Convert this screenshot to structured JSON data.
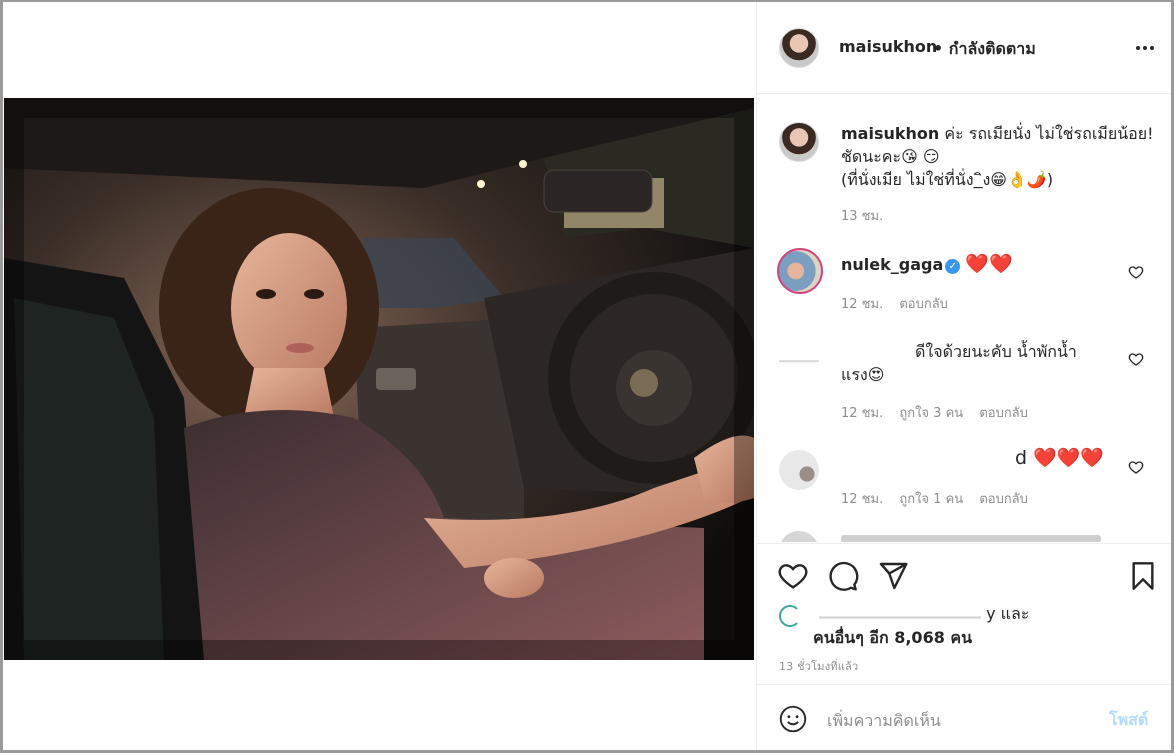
{
  "post": {
    "username": "maisukhon",
    "follow_status": "• กำลังติดตาม",
    "caption": {
      "username": "maisukhon",
      "line1": "ค่ะ รถเมียนั่ง ไม่ใช่รถเมียน้อย!",
      "line2": "ชัดนะคะ😘 😏",
      "line3": "(ที่นั่งเมีย ไม่ใช่ที่นั่ง_ิง😁👌🌶️)",
      "time": "13 ชม."
    },
    "comments": [
      {
        "username": "nulek_gaga",
        "verified_mark": "✓",
        "text": "❤️❤️",
        "time": "12 ชม.",
        "reply": "ตอบกลับ"
      },
      {
        "line1": "ดีใจด้วยนะคับ น้ำพักน้ำ",
        "line2": "แรง😍",
        "time": "12 ชม.",
        "likes": "ถูกใจ 3 คน",
        "reply": "ตอบกลับ"
      },
      {
        "text": "d ❤️❤️❤️",
        "time": "12 ชม.",
        "likes": "ถูกใจ 1 คน",
        "reply": "ตอบกลับ"
      }
    ],
    "likes_partial": "y และ",
    "likes_line": "คนอื่นๆ อีก 8,068 คน",
    "posted_ago": "13 ชั่วโมงที่แล้ว",
    "comment_placeholder": "เพิ่มความคิดเห็น",
    "post_button": "โพสต์",
    "icons": {
      "more": "more-horizontal-icon",
      "like": "heart-outline-icon",
      "comment": "comment-bubble-icon",
      "share": "paper-plane-icon",
      "save": "bookmark-icon",
      "emoji": "smiley-icon"
    },
    "colors": {
      "text": "#262626",
      "muted": "#8e8e8e",
      "post_button_disabled": "#b3dbff",
      "verified": "#3897f0",
      "heart": "#e0112b"
    }
  }
}
